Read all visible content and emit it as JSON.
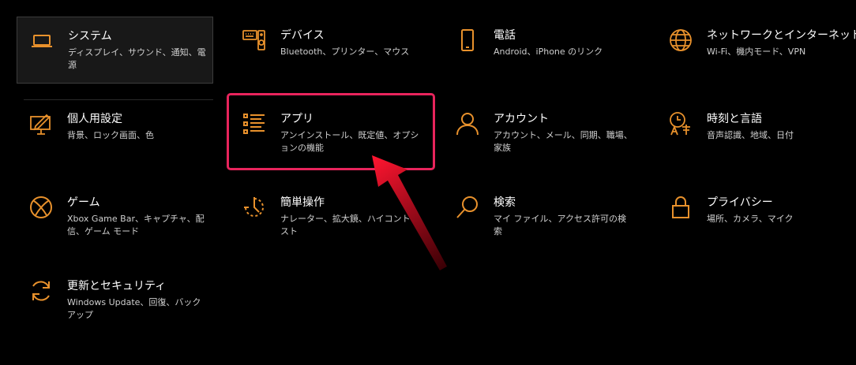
{
  "accent": "#E8912C",
  "highlight_color": "#E8245C",
  "arrow_color": "#D4001A",
  "tiles": [
    {
      "id": "system",
      "icon": "laptop-icon",
      "title": "システム",
      "desc": "ディスプレイ、サウンド、通知、電源"
    },
    {
      "id": "devices",
      "icon": "keyboard-speaker-icon",
      "title": "デバイス",
      "desc": "Bluetooth、プリンター、マウス"
    },
    {
      "id": "phone",
      "icon": "phone-icon",
      "title": "電話",
      "desc": "Android、iPhone のリンク"
    },
    {
      "id": "network",
      "icon": "globe-icon",
      "title": "ネットワークとインターネット",
      "desc": "Wi-Fi、機内モード、VPN"
    },
    {
      "id": "personalization",
      "icon": "paint-monitor-icon",
      "title": "個人用設定",
      "desc": "背景、ロック画面、色"
    },
    {
      "id": "apps",
      "icon": "apps-list-icon",
      "title": "アプリ",
      "desc": "アンインストール、既定値、オプションの機能"
    },
    {
      "id": "accounts",
      "icon": "person-icon",
      "title": "アカウント",
      "desc": "アカウント、メール、同期、職場、家族"
    },
    {
      "id": "time",
      "icon": "clock-language-icon",
      "title": "時刻と言語",
      "desc": "音声認識、地域、日付"
    },
    {
      "id": "gaming",
      "icon": "xbox-icon",
      "title": "ゲーム",
      "desc": "Xbox Game Bar、キャプチャ、配信、ゲーム モード"
    },
    {
      "id": "ease",
      "icon": "ease-of-access-icon",
      "title": "簡単操作",
      "desc": "ナレーター、拡大鏡、ハイコントラスト"
    },
    {
      "id": "search",
      "icon": "search-icon",
      "title": "検索",
      "desc": "マイ ファイル、アクセス許可の検索"
    },
    {
      "id": "privacy",
      "icon": "lock-icon",
      "title": "プライバシー",
      "desc": "場所、カメラ、マイク"
    },
    {
      "id": "update",
      "icon": "refresh-icon",
      "title": "更新とセキュリティ",
      "desc": "Windows Update、回復、バックアップ"
    }
  ]
}
